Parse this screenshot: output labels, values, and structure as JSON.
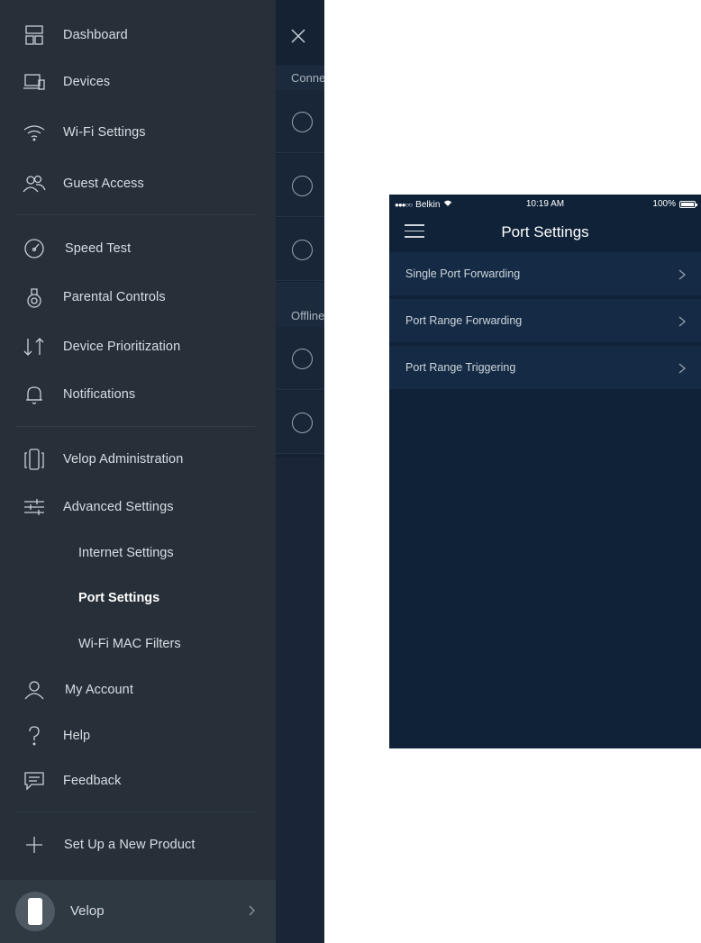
{
  "drawer": {
    "items": [
      {
        "label": "Dashboard",
        "icon": "dashboard-icon"
      },
      {
        "label": "Devices",
        "icon": "devices-icon"
      },
      {
        "label": "Wi-Fi Settings",
        "icon": "wifi-icon"
      },
      {
        "label": "Guest Access",
        "icon": "guest-access-icon"
      },
      {
        "label": "Speed Test",
        "icon": "speed-test-icon"
      },
      {
        "label": "Parental Controls",
        "icon": "parental-controls-icon"
      },
      {
        "label": "Device Prioritization",
        "icon": "prioritization-icon"
      },
      {
        "label": "Notifications",
        "icon": "bell-icon"
      },
      {
        "label": "Velop Administration",
        "icon": "velop-admin-icon"
      },
      {
        "label": "Advanced Settings",
        "icon": "sliders-icon"
      },
      {
        "label": "My Account",
        "icon": "account-icon"
      },
      {
        "label": "Help",
        "icon": "help-icon"
      },
      {
        "label": "Feedback",
        "icon": "feedback-icon"
      },
      {
        "label": "Set Up a New Product",
        "icon": "plus-icon"
      }
    ],
    "advanced_sub": [
      {
        "label": "Internet Settings",
        "active": false
      },
      {
        "label": "Port Settings",
        "active": true
      },
      {
        "label": "Wi-Fi MAC Filters",
        "active": false
      }
    ],
    "footer": {
      "label": "Velop"
    }
  },
  "background_screen": {
    "connected_label": "Connected",
    "offline_label": "Offline"
  },
  "phone": {
    "status": {
      "carrier": "Belkin",
      "signal": "●●●○○",
      "time": "10:19 AM",
      "battery": "100%"
    },
    "title": "Port Settings",
    "options": [
      {
        "label": "Single Port Forwarding"
      },
      {
        "label": "Port Range Forwarding"
      },
      {
        "label": "Port Range Triggering"
      }
    ]
  },
  "colors": {
    "drawer_bg": "#273039",
    "phone_bg": "#0f2238",
    "row_bg": "#142a45"
  }
}
